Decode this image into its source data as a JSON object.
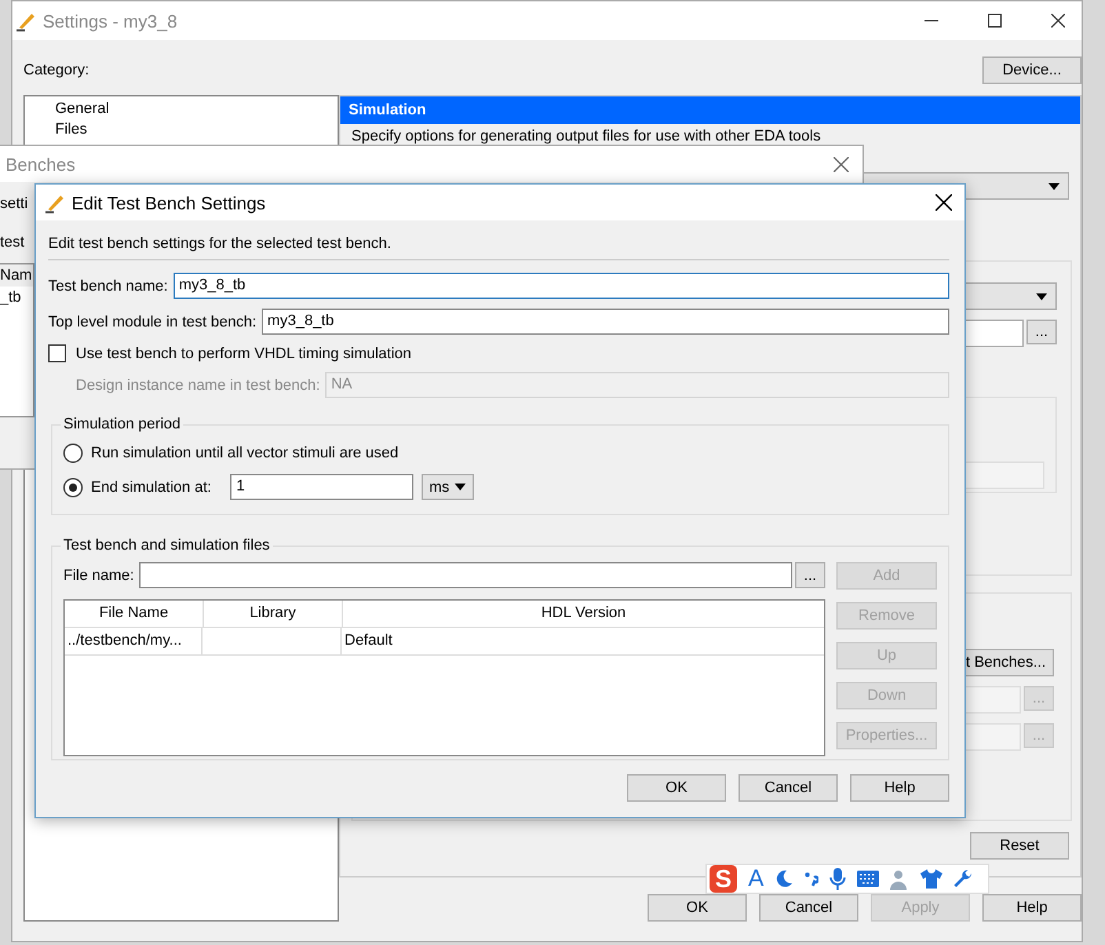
{
  "settings_window": {
    "title": "Settings - my3_8",
    "category_label": "Category:",
    "device_button": "Device...",
    "categories": [
      {
        "label": "General"
      },
      {
        "label": "Files"
      }
    ],
    "panel_title": "Simulation",
    "panel_description": "Specify options for generating output files for use with other EDA tools",
    "test_benches_button": "t Benches...",
    "browse_buttons": [
      {
        "label": "...",
        "disabled": false
      },
      {
        "label": "...",
        "disabled": true
      },
      {
        "label": "...",
        "disabled": true
      }
    ],
    "reset_button": "Reset",
    "buttons": [
      {
        "label": "OK",
        "disabled": false
      },
      {
        "label": "Cancel",
        "disabled": false
      },
      {
        "label": "Apply",
        "disabled": true
      },
      {
        "label": "Help",
        "disabled": false
      }
    ]
  },
  "test_benches_window": {
    "title": "Benches",
    "labels": [
      "setti",
      "test"
    ],
    "list_header": "Nam",
    "list_item": "_tb"
  },
  "dialog": {
    "title": "Edit Test Bench Settings",
    "intro": "Edit test bench settings for the selected test bench.",
    "test_bench_name": {
      "label": "Test bench name:",
      "value": "my3_8_tb"
    },
    "top_level_module": {
      "label": "Top level module in test bench:",
      "value": "my3_8_tb"
    },
    "vhdl_timing": {
      "label": "Use test bench to perform VHDL timing simulation",
      "checked": false
    },
    "design_instance": {
      "label": "Design instance name in test bench:",
      "value": "NA",
      "disabled": true
    },
    "simulation_period": {
      "title": "Simulation period",
      "options": [
        {
          "label": "Run simulation until all vector stimuli are used",
          "selected": false
        },
        {
          "label": "End simulation at:",
          "selected": true
        }
      ],
      "end_value": "1",
      "unit": "ms"
    },
    "files": {
      "title": "Test bench and simulation files",
      "file_name_label": "File name:",
      "browse": "...",
      "columns": [
        "File Name",
        "Library",
        "HDL Version"
      ],
      "rows": [
        {
          "file_name": "../testbench/my...",
          "hdl_version": "Default"
        }
      ],
      "buttons": [
        {
          "label": "Add",
          "disabled": true
        },
        {
          "label": "Remove",
          "disabled": true
        },
        {
          "label": "Up",
          "disabled": true
        },
        {
          "label": "Down",
          "disabled": true
        },
        {
          "label": "Properties...",
          "disabled": true
        }
      ]
    },
    "buttons": [
      "OK",
      "Cancel",
      "Help"
    ]
  },
  "ime_toolbar": {
    "logo": "S",
    "letter": "A"
  }
}
